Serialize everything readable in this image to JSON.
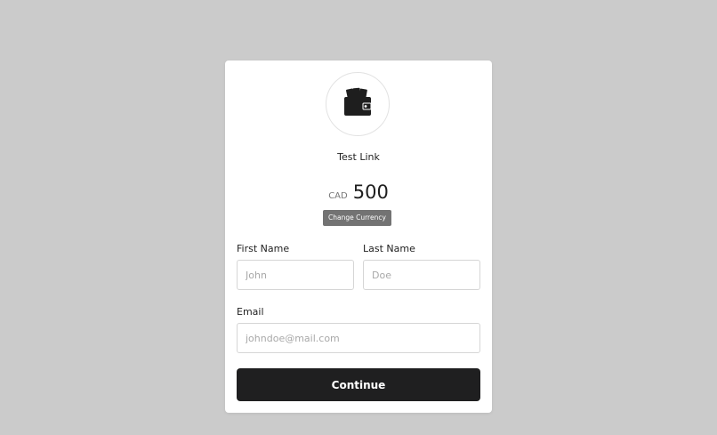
{
  "link": {
    "title": "Test Link"
  },
  "amount": {
    "currency": "CAD",
    "value": "500"
  },
  "change_currency_label": "Change Currency",
  "form": {
    "first_name": {
      "label": "First Name",
      "placeholder": "John"
    },
    "last_name": {
      "label": "Last Name",
      "placeholder": "Doe"
    },
    "email": {
      "label": "Email",
      "placeholder": "johndoe@mail.com"
    }
  },
  "continue_label": "Continue",
  "icons": {
    "logo": "wallet-icon"
  },
  "colors": {
    "background": "#cbcbcb",
    "card": "#ffffff",
    "primary": "#1f1f20",
    "secondary_button": "#737373"
  }
}
